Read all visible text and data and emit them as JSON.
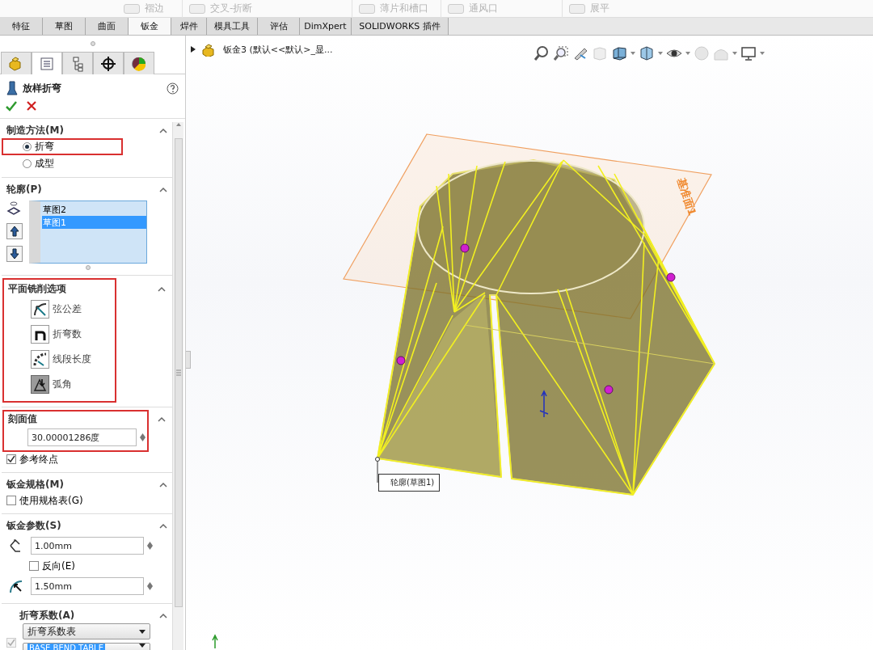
{
  "ribbon": [
    {
      "label": "褶边",
      "disabled": true
    },
    {
      "label": "交叉-折断",
      "disabled": true
    },
    {
      "label": "薄片和槽口",
      "disabled": true
    },
    {
      "label": "通风口",
      "disabled": true
    },
    {
      "label": "展平",
      "disabled": true
    }
  ],
  "tabs": [
    {
      "label": "特征",
      "selected": false
    },
    {
      "label": "草图",
      "selected": false
    },
    {
      "label": "曲面",
      "selected": false
    },
    {
      "label": "钣金",
      "selected": true
    },
    {
      "label": "焊件",
      "selected": false
    },
    {
      "label": "模具工具",
      "selected": false
    },
    {
      "label": "评估",
      "selected": false
    },
    {
      "label": "DimXpert",
      "selected": false
    },
    {
      "label": "SOLIDWORKS 插件",
      "selected": false
    }
  ],
  "panel_tabs": [
    {
      "kind": "feature",
      "selected": false
    },
    {
      "kind": "property",
      "selected": true
    },
    {
      "kind": "config",
      "selected": false
    },
    {
      "kind": "dimxpert",
      "selected": false
    },
    {
      "kind": "display",
      "selected": false
    }
  ],
  "property_manager": {
    "title": "放样折弯"
  },
  "sections": [
    {
      "kind": "radios",
      "title": "制造方法(M)",
      "expanded": true,
      "options": [
        {
          "label": "折弯",
          "selected": true,
          "highlighted": true
        },
        {
          "label": "成型",
          "selected": false,
          "highlighted": false
        }
      ]
    },
    {
      "kind": "profiles",
      "title": "轮廓(P)",
      "expanded": true,
      "items": [
        {
          "label": "草图2",
          "selected": false
        },
        {
          "label": "草图1",
          "selected": true
        }
      ]
    },
    {
      "kind": "options",
      "title": "平面铣削选项",
      "expanded": true,
      "highlighted": true,
      "options": [
        {
          "kind": "chord",
          "label": "弦公差",
          "selected": false
        },
        {
          "kind": "count",
          "label": "折弯数",
          "selected": false
        },
        {
          "kind": "length",
          "label": "线段长度",
          "selected": false
        },
        {
          "kind": "angle",
          "label": "弧角",
          "selected": true
        }
      ]
    },
    {
      "kind": "facet",
      "title": "刻面值",
      "expanded": true,
      "highlighted": true,
      "value": "30.00001286度",
      "checkbox": {
        "label": "参考终点",
        "checked": true
      }
    },
    {
      "kind": "gauge",
      "title": "钣金规格(M)",
      "expanded": true,
      "checkbox": {
        "label": "使用规格表(G)",
        "checked": false
      }
    },
    {
      "kind": "params",
      "title": "钣金参数(S)",
      "expanded": true,
      "thickness": "1.00mm",
      "reverse": {
        "label": "反向(E)",
        "checked": false
      },
      "radius": "1.50mm"
    },
    {
      "kind": "allowance",
      "title": "折弯系数(A)",
      "expanded": true,
      "checkbox": {
        "checked": true,
        "disabled": true
      },
      "type": "折弯系数表",
      "table": "BASE BEND TABLE"
    }
  ],
  "tree": {
    "label": "钣金3  (默认<<默认>_显..."
  },
  "model": {
    "plane_label": "基准面1",
    "callout": "轮廓(草图1)"
  }
}
